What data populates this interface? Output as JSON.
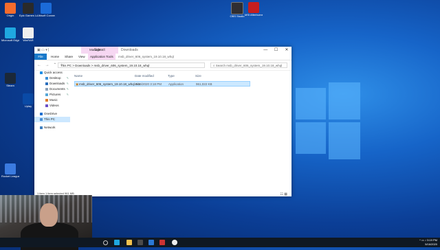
{
  "desktop_icons": [
    {
      "label": "Origin",
      "color": "#f56c2d"
    },
    {
      "label": "Epic Games Launcher",
      "color": "#2a2a2a"
    },
    {
      "label": "Ubisoft Connect",
      "color": "#1b6bd8"
    },
    {
      "label": "Microsoft Edge",
      "color": "#1fa7e0"
    },
    {
      "label": "WinRAR",
      "color": "#eeeeee"
    },
    {
      "label": "Steam",
      "color": "#1b2838"
    },
    {
      "label": "Uplay",
      "color": "#0a4aa6"
    },
    {
      "label": "Rocket League",
      "color": "#3b7be0"
    }
  ],
  "top_icons": [
    {
      "label": "OBS Studio",
      "color": "#302e31"
    },
    {
      "label": "MSI Afterburner",
      "color": "#c61e1e"
    }
  ],
  "explorer": {
    "quick_access_toolbar": "▣ ▭ ▾ |",
    "context_tab": "Extract",
    "window_title": "Downloads",
    "ctrl_min": "—",
    "ctrl_max": "☐",
    "ctrl_close": "✕",
    "ribbon_tabs": [
      "File",
      "Home",
      "Share",
      "View",
      "Application Tools"
    ],
    "manage_tab": "Manage",
    "ribbon_subtitle": "msb_driver_606_system_19.10.18_whql",
    "address_path": "This PC  >  Downloads  >  msb_driver_606_system_19.10.18_whql",
    "search_placeholder": "Search msb_driver_606_system_19.10.18_whql",
    "nav": [
      {
        "label": "Quick access",
        "sub": false,
        "pin": false,
        "color": "#1e8ee6"
      },
      {
        "label": "Desktop",
        "sub": true,
        "pin": true,
        "color": "#3a8fd8"
      },
      {
        "label": "Downloads",
        "sub": true,
        "pin": true,
        "color": "#2a6ebd"
      },
      {
        "label": "Documents",
        "sub": true,
        "pin": true,
        "color": "#8aa0b8"
      },
      {
        "label": "Pictures",
        "sub": true,
        "pin": true,
        "color": "#55a7d8"
      },
      {
        "label": "Music",
        "sub": true,
        "pin": false,
        "color": "#e07b2a"
      },
      {
        "label": "Videos",
        "sub": true,
        "pin": false,
        "color": "#6b4fc8"
      },
      {
        "label": "OneDrive",
        "sub": false,
        "pin": false,
        "color": "#1e6fd0"
      },
      {
        "label": "This PC",
        "sub": false,
        "pin": false,
        "color": "#4a90d6"
      },
      {
        "label": "Network",
        "sub": false,
        "pin": false,
        "color": "#3f7fbf"
      }
    ],
    "columns": {
      "name": "Name",
      "date": "Date modified",
      "type": "Type",
      "size": "Size"
    },
    "file": {
      "name": "msb_driver_606_system_19.10.18_whql.exe",
      "date": "5/16/2020 3:18 PM",
      "type": "Application",
      "size": "961,022 KB"
    },
    "status": "1 item    1 item selected  961 MB"
  },
  "taskbar": {
    "time": "3:19 PM",
    "date": "5/16/2020",
    "tray_glyphs": "^ ▭ ♪"
  }
}
